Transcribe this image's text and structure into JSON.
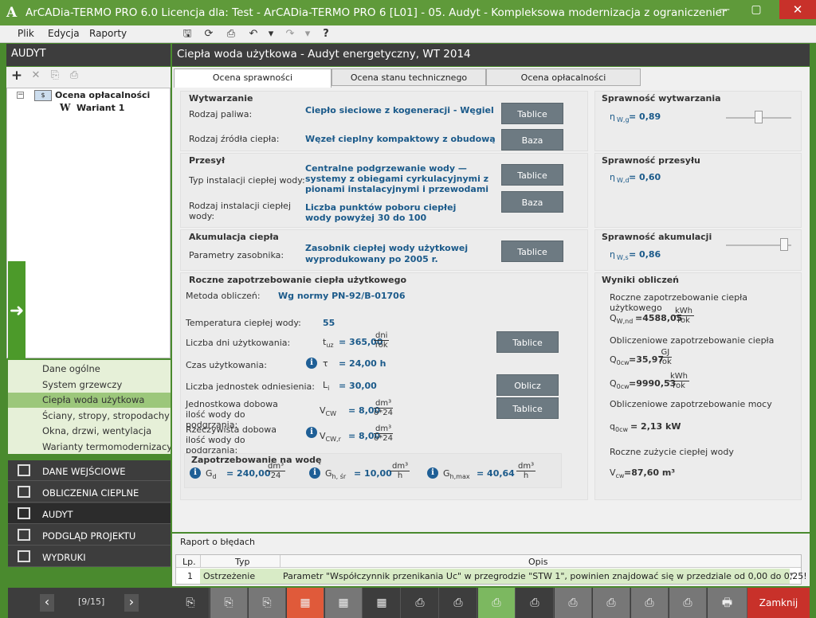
{
  "app": {
    "logo": "A",
    "title": "ArCADia-TERMO PRO 6.0 Licencja dla: Test - ArCADia-TERMO PRO 6 [L01] - 05. Audyt - Kompleksowa modernizacja z ograniczeniem śr...",
    "min": "—",
    "max": "▢",
    "close": "✕"
  },
  "menu": [
    "Plik",
    "Edycja",
    "Raporty"
  ],
  "toolbar": {
    "save": "🖫",
    "refresh": "⟳",
    "preview": "⎙",
    "undo": "↶",
    "dd1": "▾",
    "redo": "↷",
    "dd2": "▾",
    "help": "?"
  },
  "left": {
    "header": "AUDYT",
    "tools": [
      "+",
      "✕",
      "⎘",
      "⎙"
    ],
    "tree": {
      "root": "Ocena opłacalności",
      "child_icon": "W",
      "child": "Wariant 1"
    },
    "subnav": [
      "Dane ogólne",
      "System grzewczy",
      "Ciepła woda użytkowa",
      "Ściany, stropy, stropodachy",
      "Okna, drzwi, wentylacja",
      "Warianty termomodernizacyjne"
    ],
    "mainnav": [
      "DANE WEJŚCIOWE",
      "OBLICZENIA CIEPLNE",
      "AUDYT",
      "PODGLĄD PROJEKTU",
      "WYDRUKI"
    ],
    "pager": {
      "prev": "‹",
      "text": "[9/15]",
      "next": "›"
    }
  },
  "main": {
    "header": "Ciepła woda użytkowa - Audyt energetyczny, WT 2014",
    "tabs": [
      "Ocena sprawności",
      "Ocena stanu technicznego",
      "Ocena opłacalności"
    ],
    "wytwarzanie": {
      "title": "Wytwarzanie",
      "fuel_label": "Rodzaj paliwa:",
      "fuel_value": "Ciepło sieciowe z kogeneracji - Węgiel",
      "fuel_btn": "Tablice",
      "source_label": "Rodzaj źródła ciepła:",
      "source_value": "Węzeł cieplny kompaktowy z obudową",
      "source_btn": "Baza"
    },
    "przesyl": {
      "title": "Przesył",
      "type_label": "Typ instalacji ciepłej wody:",
      "type_value": "Centralne podgrzewanie wody — systemy z obiegami cyrkulacyjnymi z pionami instalacyjnymi i przewodami",
      "type_btn": "Tablice",
      "kind_label": "Rodzaj instalacji ciepłej wody:",
      "kind_value": "Liczba punktów poboru ciepłej wody powyżej 30 do 100",
      "kind_btn": "Baza"
    },
    "akumulacja": {
      "title": "Akumulacja ciepła",
      "params_label": "Parametry zasobnika:",
      "params_value": "Zasobnik ciepłej wody użytkowej wyprodukowany po 2005 r.",
      "params_btn": "Tablice"
    },
    "eff": {
      "w_title": "Sprawność wytwarzania",
      "w_sym": "η",
      "w_sub": "W,g",
      "w_val": "= 0,89",
      "w_level": 0.5,
      "p_title": "Sprawność przesyłu",
      "p_sym": "η",
      "p_sub": "W,d",
      "p_val": "= 0,60",
      "a_title": "Sprawność akumulacji",
      "a_sym": "η",
      "a_sub": "W,s",
      "a_val": "= 0,86",
      "a_level": 0.95
    },
    "roczne": {
      "title": "Roczne zapotrzebowanie ciepła użytkowego",
      "method_label": "Metoda obliczeń:",
      "method_value": "Wg normy PN-92/B-01706",
      "temp_label": "Temperatura ciepłej wody:",
      "temp_value": "55",
      "days_label": "Liczba dni użytkowania:",
      "days_sym": "t",
      "days_sub": "uz",
      "days_val": "= 365,00",
      "days_num": "dni",
      "days_den": "rok",
      "days_btn": "Tablice",
      "time_label": "Czas użytkowania:",
      "time_sym": "τ",
      "time_val": "= 24,00 h",
      "units_label": "Liczba jednostek odniesienia:",
      "units_sym": "L",
      "units_sub": "i",
      "units_val": "= 30,00",
      "units_btn": "Oblicz",
      "unit_daily_label": "Jednostkowa dobowa ilość wody do podgrzania:",
      "unit_daily_sym": "V",
      "unit_daily_sub": "CW",
      "unit_daily_val": "= 8,00",
      "unit_daily_num": "dm³",
      "unit_daily_den": "o*24",
      "unit_daily_btn": "Tablice",
      "real_daily_label": "Rzeczywista dobowa ilość wody do podgrzania:",
      "real_daily_sym": "V",
      "real_daily_sub": "CW,r",
      "real_daily_val": "= 8,00",
      "real_daily_num": "dm³",
      "real_daily_den": "o*24"
    },
    "woda": {
      "title": "Zapotrzebowanie na wodę",
      "gd_sym": "G",
      "gd_sub": "d",
      "gd_val": "= 240,00",
      "gd_num": "dm³",
      "gd_den": "24",
      "gh_sym": "G",
      "gh_sub": "h, śr",
      "gh_val": "= 10,00",
      "gh_num": "dm³",
      "gh_den": "h",
      "gm_sym": "G",
      "gm_sub": "h,max",
      "gm_val": "= 40,64",
      "gm_num": "dm³",
      "gm_den": "h"
    },
    "wyniki": {
      "title": "Wyniki obliczeń",
      "r1_label": "Roczne zapotrzebowanie ciepła użytkowego",
      "r1_sym": "Q",
      "r1_sub": "W,nd",
      "r1_val": "=4588,05",
      "r1_num": "kWh",
      "r1_den": "rok",
      "r2_label": "Obliczeniowe zapotrzebowanie ciepła",
      "r2a_sym": "Q",
      "r2a_sub": "0cw",
      "r2a_val": "=35,97",
      "r2a_num": "GJ",
      "r2a_den": "rok",
      "r2b_sym": "Q",
      "r2b_sub": "0cw",
      "r2b_val": "=9990,53",
      "r2b_num": "kWh",
      "r2b_den": "rok",
      "r3_label": "Obliczeniowe zapotrzebowanie mocy",
      "r3_sym": "q",
      "r3_sub": "0cw",
      "r3_val": "= 2,13 kW",
      "r4_label": "Roczne zużycie ciepłej wody",
      "r4_val": "V",
      "r4_sub": "cw",
      "r4_rest": "=87,60 m³"
    }
  },
  "report": {
    "title": "Raport o błędach",
    "headers": [
      "Lp.",
      "Typ",
      "Opis"
    ],
    "rows": [
      {
        "lp": "1",
        "typ": "Ostrzeżenie",
        "opis": "Parametr \"Współczynnik przenikania Uc\" w przegrodzie \"STW 1\", powinien znajdować się w przedziale od 0,00 do 0,25!"
      }
    ]
  },
  "bottom": {
    "close_label": "Zamknij",
    "icons": [
      "⎘",
      "⎘",
      "⎘",
      "▦",
      "▦",
      "▦",
      "⎙",
      "⎙",
      "⎙",
      "⎙",
      "⎙",
      "⎙",
      "⎙",
      "⎙",
      "🖶"
    ]
  }
}
